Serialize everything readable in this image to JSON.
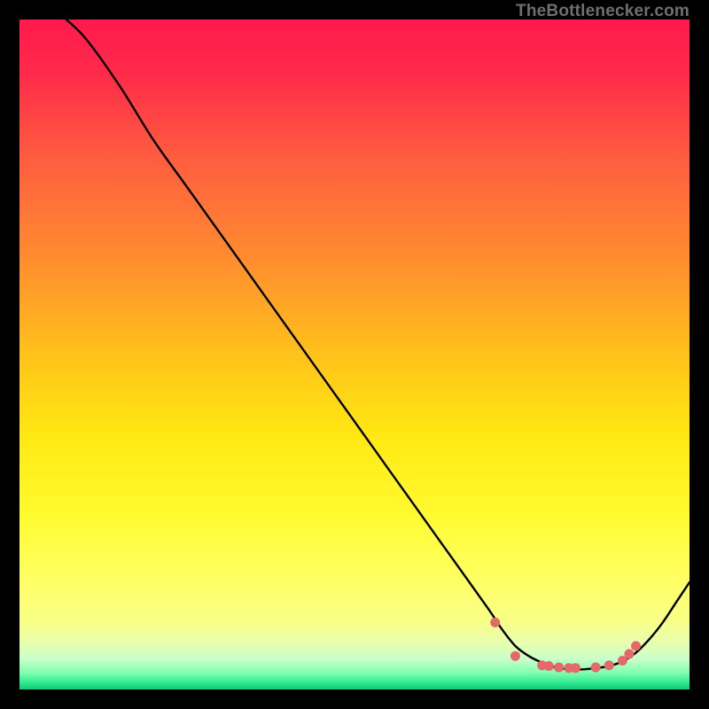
{
  "watermark": "TheBottlenecker.com",
  "chart_data": {
    "type": "line",
    "title": "",
    "xlabel": "",
    "ylabel": "",
    "xlim": [
      0,
      100
    ],
    "ylim": [
      0,
      100
    ],
    "x": [
      7,
      10,
      15,
      20,
      25,
      30,
      35,
      40,
      45,
      50,
      55,
      60,
      65,
      70,
      72,
      74,
      76,
      78,
      80,
      82,
      84,
      86,
      88,
      90,
      92,
      94,
      96,
      98,
      100
    ],
    "values": [
      100,
      97,
      90,
      82,
      75,
      68,
      61,
      54,
      47,
      40,
      33,
      26,
      19,
      12,
      9,
      6.5,
      5,
      4,
      3.3,
      3,
      3,
      3.2,
      3.5,
      4.2,
      5.5,
      7.5,
      10,
      13,
      16
    ],
    "markers": {
      "x": [
        71,
        74,
        78,
        79,
        80.5,
        82,
        83,
        86,
        88,
        90,
        91,
        92
      ],
      "values": [
        10,
        5,
        3.6,
        3.5,
        3.3,
        3.2,
        3.2,
        3.3,
        3.6,
        4.3,
        5.3,
        6.5
      ]
    },
    "gradient_stops": [
      {
        "pos": 0.0,
        "color": "#ff1a4d"
      },
      {
        "pos": 0.08,
        "color": "#ff2a4a"
      },
      {
        "pos": 0.2,
        "color": "#ff5a40"
      },
      {
        "pos": 0.35,
        "color": "#ff8a30"
      },
      {
        "pos": 0.5,
        "color": "#ffc21a"
      },
      {
        "pos": 0.62,
        "color": "#ffe812"
      },
      {
        "pos": 0.74,
        "color": "#fffb30"
      },
      {
        "pos": 0.84,
        "color": "#ffff66"
      },
      {
        "pos": 0.9,
        "color": "#f8ff88"
      },
      {
        "pos": 0.93,
        "color": "#e8ffb0"
      },
      {
        "pos": 0.955,
        "color": "#c8ffc8"
      },
      {
        "pos": 0.975,
        "color": "#80ffb0"
      },
      {
        "pos": 0.99,
        "color": "#30e890"
      },
      {
        "pos": 1.0,
        "color": "#10c878"
      }
    ]
  }
}
